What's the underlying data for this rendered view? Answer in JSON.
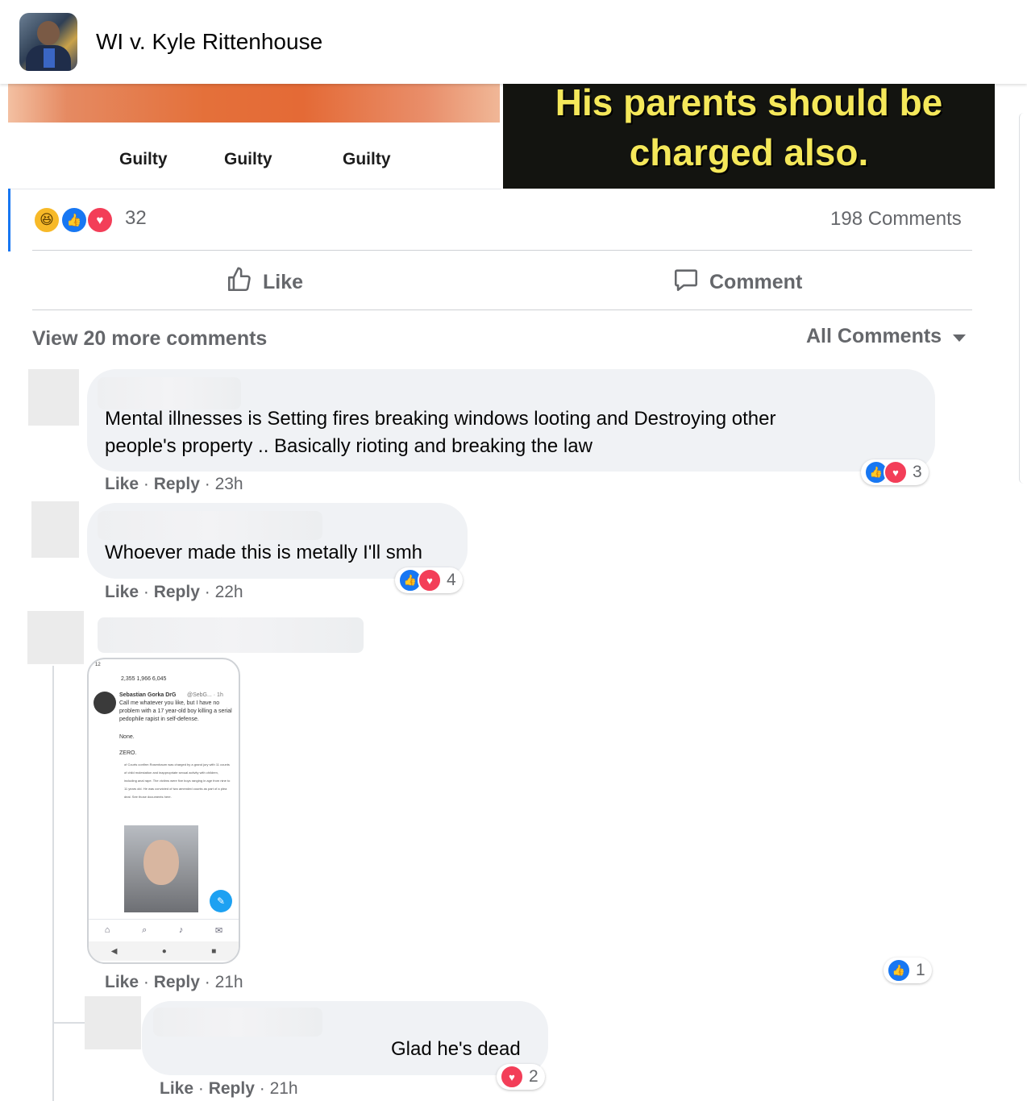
{
  "header": {
    "title": "WI v. Kyle Rittenhouse",
    "avatar_icon": "group-avatar"
  },
  "post_image": {
    "left_labels": [
      "Guilty",
      "Guilty",
      "Guilty"
    ],
    "right_text": [
      "His parents should be",
      "charged also."
    ]
  },
  "reactions": {
    "count": "32",
    "icons": [
      "haha-icon",
      "like-icon",
      "love-icon"
    ],
    "comments_count": "198 Comments"
  },
  "actions": {
    "like": "Like",
    "comment": "Comment"
  },
  "comments_header": {
    "view_more": "View 20 more comments",
    "filter": "All Comments"
  },
  "comments": [
    {
      "text_line1": "Mental illnesses is Setting fires breaking windows looting and Destroying other",
      "text_line2": "people's property .. Basically rioting and breaking the law",
      "like": "Like",
      "reply": "Reply",
      "time": "23h",
      "reaction_count": "3"
    },
    {
      "text": "Whoever made this is metally I'll smh",
      "like": "Like",
      "reply": "Reply",
      "time": "22h",
      "reaction_count": "4"
    },
    {
      "like": "Like",
      "reply": "Reply",
      "time": "21h",
      "reaction_count": "1",
      "screenshot": {
        "stats": "2,355   1,966   6,045",
        "author": "Sebastian Gorka DrG",
        "handle": "@SebG... · 1h",
        "tweet": "Call me whatever you like, but I have no problem with a 17 year-old boy killing a serial pedophile rapist in self-defense.",
        "none": "None.",
        "zero": "ZERO.",
        "quote": "of Courts confirm Rosenbaum was charged by a grand jury with 11 counts of child molestation and inappropriate sexual activity with children, including anal rape. The victims were five boys ranging in age from nine to 11 years old. He was convicted of two amended counts as part of a plea deal. See those documents here."
      }
    },
    {
      "text": "Glad he's dead",
      "like": "Like",
      "reply": "Reply",
      "time": "21h",
      "reaction_count": "2"
    }
  ],
  "colors": {
    "like_blue": "#1877f2",
    "love_red": "#f33e58",
    "haha_yellow": "#f7b928",
    "bubble": "#f0f2f5",
    "meta_gray": "#65676b"
  }
}
